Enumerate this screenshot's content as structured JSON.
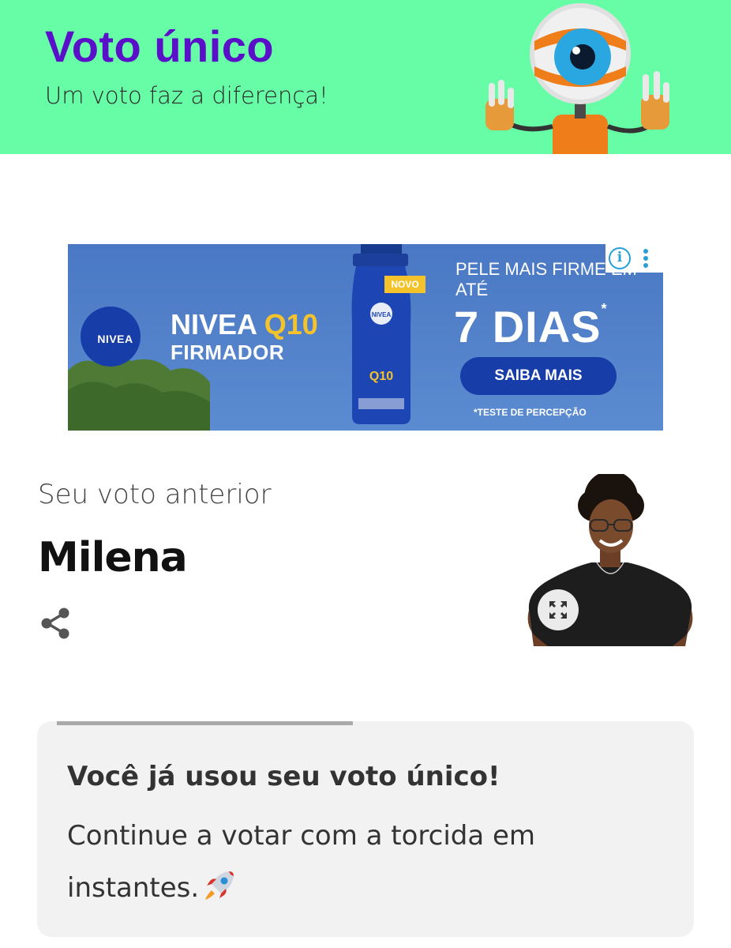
{
  "header": {
    "title": "Voto único",
    "subtitle": "Um voto faz a diferença!",
    "background": "#67fca6",
    "title_color": "#5a10c8",
    "mascot_icon": "big-brother-eye-mascot"
  },
  "ad": {
    "logo": "NIVEA",
    "brand_line1": "NIVEA",
    "brand_q10": "Q10",
    "brand_line2": "FIRMADOR",
    "badge": "NOVO",
    "headline": "PELE MAIS FIRME EM ATÉ",
    "days": "7 DIAS",
    "asterisk": "*",
    "cta": "SAIBA MAIS",
    "footnote": "*TESTE DE PERCEPÇÃO",
    "info_icon": "info-icon",
    "more_icon": "more-vertical-icon"
  },
  "previous_vote": {
    "label": "Seu voto anterior",
    "name": "Milena",
    "share_icon": "share-icon",
    "expand_icon": "expand-icon"
  },
  "notice": {
    "title": "Você já usou seu voto único!",
    "body": "Continue a votar com a torcida em instantes.",
    "icon": "rocket-icon"
  }
}
